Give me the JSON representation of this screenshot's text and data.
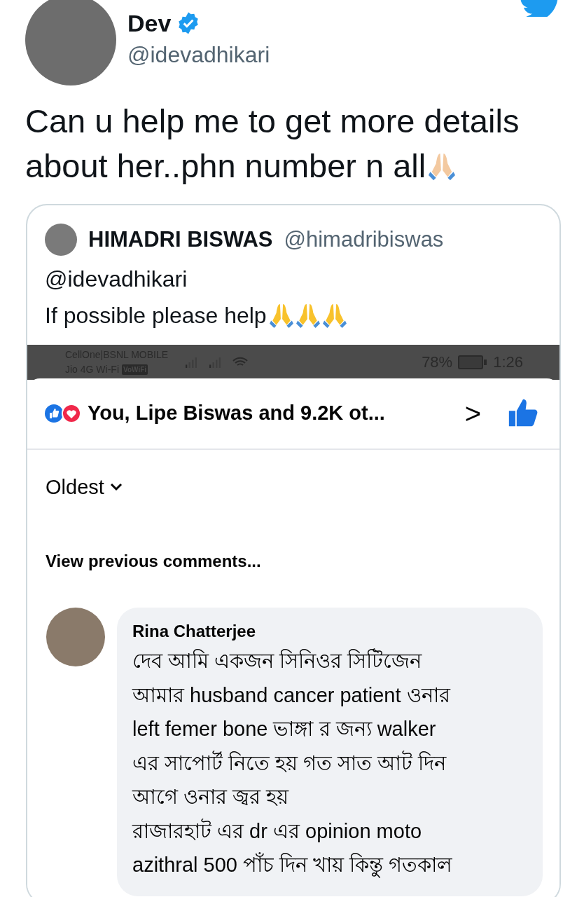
{
  "author": {
    "name": "Dev",
    "verified": true,
    "handle": "@idevadhikari"
  },
  "tweet": {
    "lines": [
      "Can u help me to get more details",
      "about her..phn number n all"
    ],
    "emojis": [
      {
        "kind": "folded-hands-light"
      }
    ]
  },
  "quote": {
    "name": "HIMADRI BISWAS",
    "handle": "@himadribiswas",
    "mention": "@idevadhikari",
    "text": "If possible please help",
    "emojis": [
      {
        "kind": "folded-hands-yellow"
      },
      {
        "kind": "folded-hands-yellow"
      },
      {
        "kind": "folded-hands-yellow"
      }
    ]
  },
  "phone_status_bar": {
    "carrier_1": "CellOne|BSNL MOBILE",
    "carrier_2": "Jio 4G Wi-Fi",
    "wifi_badge": "VoWiFi",
    "battery": "78%",
    "time": "1:26"
  },
  "reactions": {
    "summary": "You, Lipe Biswas and 9.2K ot...",
    "chevron": ">"
  },
  "sort": {
    "label": "Oldest"
  },
  "view_previous": "View previous comments...",
  "comment": {
    "name": "Rina Chatterjee",
    "text": "দেব আমি একজন সিনিওর সিটিজেন\nআমার husband cancer patient ওনার\nleft femer bone  ভাঙ্গা র জন্য walker\nএর সাপোর্ট নিতে হয় গত সাত আট দিন\nআগে ওনার জ্বর হয়\nরাজারহাট এর dr এর opinion moto\nazithral 500 পাঁচ দিন খায় কিন্তু গতকাল"
  }
}
